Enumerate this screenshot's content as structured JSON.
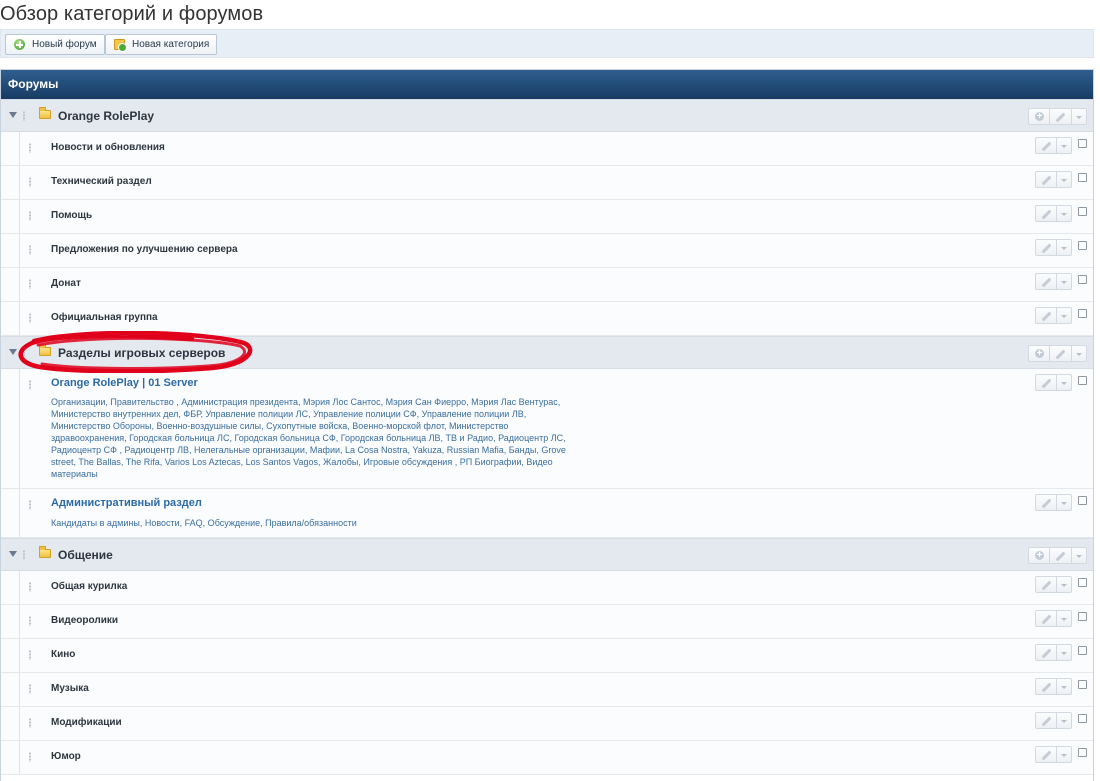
{
  "page_title": "Обзор категорий и форумов",
  "toolbar": {
    "new_forum": "Новый форум",
    "new_category": "Новая категория"
  },
  "panel": {
    "title": "Форумы"
  },
  "categories": [
    {
      "title": "Orange RolePlay",
      "forums": [
        {
          "name": "Новости и обновления"
        },
        {
          "name": "Технический раздел"
        },
        {
          "name": "Помощь"
        },
        {
          "name": "Предложения по улучшению сервера"
        },
        {
          "name": "Донат"
        },
        {
          "name": "Официальная группа"
        }
      ]
    },
    {
      "title": "Разделы игровых серверов",
      "forums": [
        {
          "name": "Orange RolePlay | 01 Server",
          "subforums": "Организации, Правительство , Администрация президента, Мэрия Лос Сантос, Мэрия Сан Фиерро, Мэрия Лас Вентурас, Министерство внутренних дел, ФБР, Управление полиции ЛС, Управление полиции СФ, Управление полиции ЛВ, Министерство Обороны, Военно-воздушные силы, Сухопутные войска, Военно-морской флот, Министерство здравоохранения, Городская больница ЛС, Городская больница СФ, Городская больница ЛВ, ТВ и Радио, Радиоцентр ЛС, Радиоцентр СФ , Радиоцентр ЛВ, Нелегальные организации, Мафии, La Cosa Nostra, Yakuza, Russian Mafia, Банды, Grove street, The Ballas, The Rifa, Varios Los Aztecas, Los Santos Vagos, Жалобы, Игровые обсуждения , РП Биографии, Видео материалы"
        },
        {
          "name": "Административный раздел",
          "subforums": "Кандидаты в админы, Новости, FAQ, Обсуждение, Правила/обязанности"
        }
      ]
    },
    {
      "title": "Общение",
      "forums": [
        {
          "name": "Общая курилка"
        },
        {
          "name": "Видеоролики"
        },
        {
          "name": "Кино"
        },
        {
          "name": "Музыка"
        },
        {
          "name": "Модификации"
        },
        {
          "name": "Юмор"
        }
      ]
    }
  ],
  "colors": {
    "header_bg": "#173b63",
    "category_bg": "#e4e9ef",
    "link": "#2c6aa5",
    "annotation": "#e0001b"
  },
  "icons": [
    "add-circle-icon",
    "folder-add-icon",
    "folder-icon",
    "pencil-icon",
    "chevron-down-icon",
    "collapse-arrow-icon",
    "drag-handle-icon"
  ]
}
